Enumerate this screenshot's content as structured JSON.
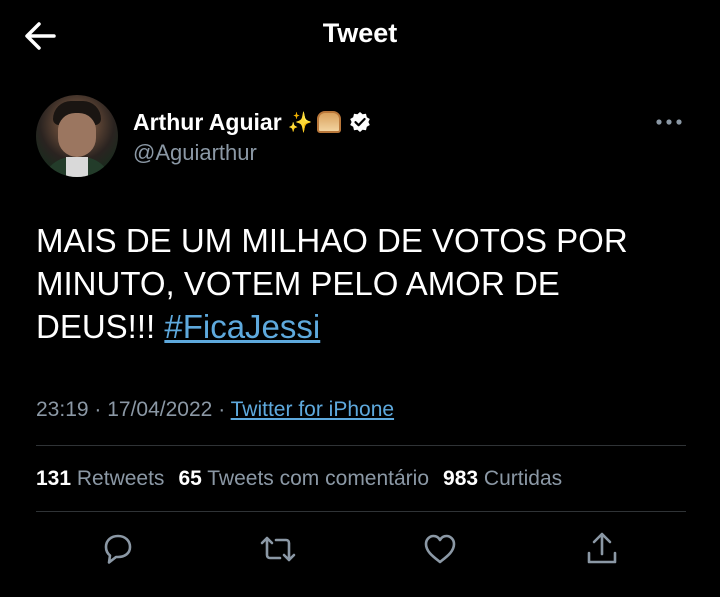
{
  "header": {
    "title": "Tweet",
    "back_icon": "arrow-left-icon"
  },
  "tweet": {
    "author_name": "Arthur Aguiar",
    "author_emojis": "✨",
    "author_bread_emoji": "bread-icon",
    "author_handle": "@Aguiarthur",
    "text_before": "MAIS DE UM MILHAO DE VOTOS POR MINUTO, VOTEM PELO AMOR DE DEUS!!! ",
    "hashtag": "#FicaJessi",
    "time": "23:19",
    "date": "17/04/2022",
    "source": "Twitter for iPhone"
  },
  "stats": {
    "retweets_count": "131",
    "retweets_label": "Retweets",
    "quotes_count": "65",
    "quotes_label": "Tweets com comentário",
    "likes_count": "983",
    "likes_label": "Curtidas"
  },
  "colors": {
    "background": "#000000",
    "link": "#5ea9dd",
    "muted": "#8b98a5",
    "divider": "#2f3336"
  },
  "actions": [
    "reply-icon",
    "retweet-icon",
    "like-icon",
    "share-icon"
  ]
}
